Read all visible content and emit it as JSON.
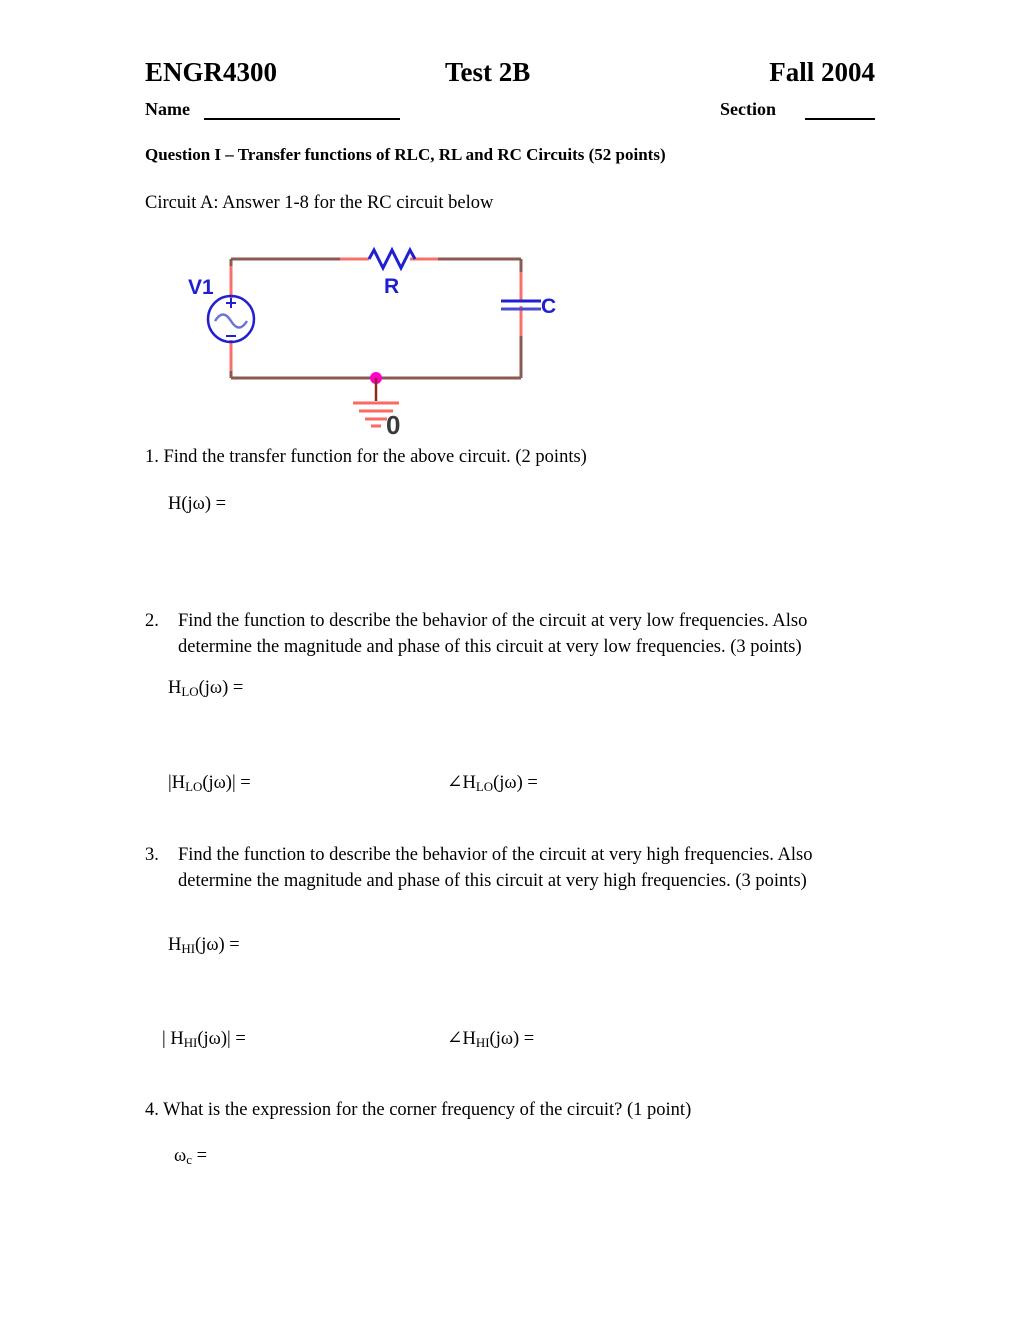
{
  "header": {
    "course": "ENGR4300",
    "test": "Test 2B",
    "term": "Fall 2004",
    "name_label": "Name",
    "section_label": "Section"
  },
  "question_heading": "Question I – Transfer functions of RLC, RL and RC Circuits (52 points)",
  "circuit_caption": "Circuit A:  Answer 1-8 for the RC circuit below",
  "circuit": {
    "source_label": "V1",
    "resistor_label": "R",
    "capacitor_label": "C",
    "ground_label": "0",
    "source_plus": "+",
    "source_minus": "–",
    "colors": {
      "wire": "#8a5a52",
      "lead": "#f9706a",
      "component": "#2020d0",
      "junction": "#ff00c8",
      "ground_stub": "#8a2a22",
      "ground_bars": "#fa6a64",
      "label_dark": "#3a3a3a"
    }
  },
  "questions": [
    {
      "number": "1.",
      "text": "1. Find the transfer function for the above circuit. (2 points)",
      "answers": [
        "H(jω) ="
      ]
    },
    {
      "number": "2.",
      "text": "Find the function to describe the behavior of the circuit at very low frequencies.  Also determine the magnitude and phase of this circuit at very low frequencies. (3 points)",
      "answers": [
        "H",
        "LO",
        "(jω) =",
        "|H",
        "LO",
        "(jω)| =",
        "∠H",
        "LO",
        "(jω) ="
      ]
    },
    {
      "number": "3.",
      "text": "Find the function to describe the behavior of the circuit at very high frequencies. Also determine the magnitude and phase of this circuit at very high frequencies. (3 points)",
      "answers": [
        "H",
        "HI",
        "(jω) =",
        "| H",
        "HI",
        "(jω)| =",
        "∠H",
        "HI",
        "(jω) ="
      ]
    },
    {
      "number": "4.",
      "text": "4. What is the expression for the corner frequency of the circuit? (1 point)",
      "answers": [
        "ω",
        "c",
        " ="
      ]
    }
  ],
  "answer_lines": {
    "h_base": "H",
    "h_paren": "(jω) =",
    "h_mag_open": "|H",
    "h_mag_close": "(jω)| =",
    "h_mag_open_spaced": "| H",
    "h_angle_open": "∠H",
    "sub_lo": "LO",
    "sub_hi": "HI",
    "omega": "ω",
    "sub_c": "c",
    "equals": " ="
  }
}
